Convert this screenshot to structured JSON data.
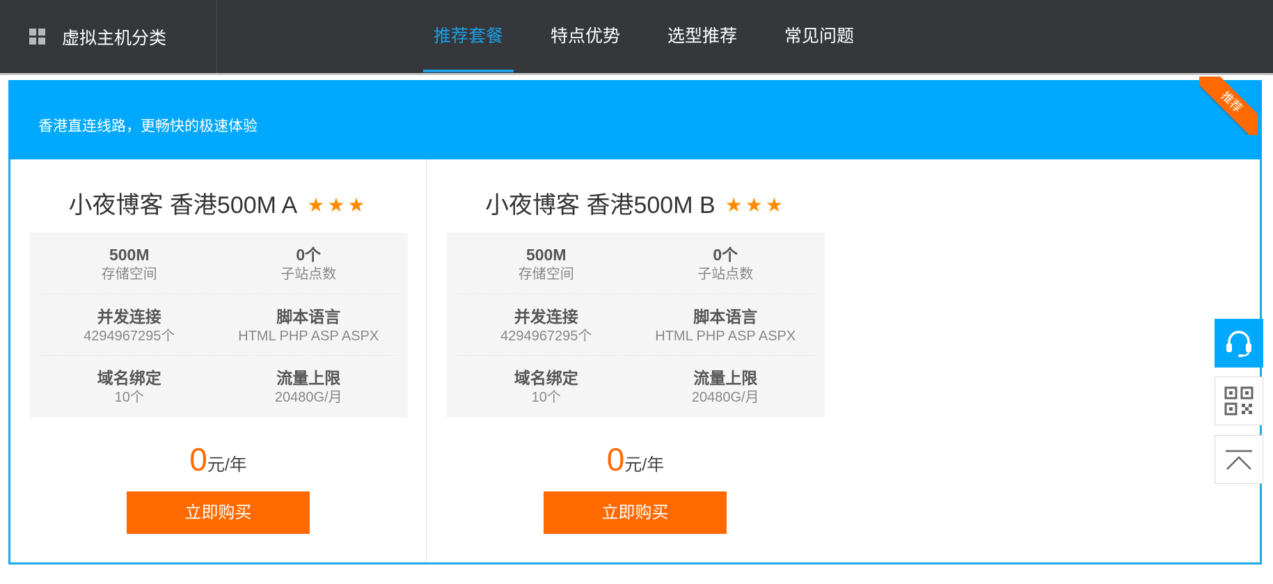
{
  "topbar": {
    "category_label": "虚拟主机分类",
    "nav": [
      {
        "label": "推荐套餐",
        "active": true
      },
      {
        "label": "特点优势",
        "active": false
      },
      {
        "label": "选型推荐",
        "active": false
      },
      {
        "label": "常见问题",
        "active": false
      }
    ]
  },
  "banner": {
    "text": "香港直连线路，更畅快的极速体验",
    "ribbon": "推荐"
  },
  "plans": [
    {
      "title": "小夜博客 香港500M A",
      "stars": "★★★",
      "specs": [
        {
          "key": "500M",
          "value": "存储空间"
        },
        {
          "key": "0个",
          "value": "子站点数"
        },
        {
          "key": "并发连接",
          "value": "4294967295个"
        },
        {
          "key": "脚本语言",
          "value": "HTML PHP ASP ASPX"
        },
        {
          "key": "域名绑定",
          "value": "10个"
        },
        {
          "key": "流量上限",
          "value": "20480G/月"
        }
      ],
      "price": "0",
      "price_unit": "元/年",
      "buy_label": "立即购买"
    },
    {
      "title": "小夜博客 香港500M B",
      "stars": "★★★",
      "specs": [
        {
          "key": "500M",
          "value": "存储空间"
        },
        {
          "key": "0个",
          "value": "子站点数"
        },
        {
          "key": "并发连接",
          "value": "4294967295个"
        },
        {
          "key": "脚本语言",
          "value": "HTML PHP ASP ASPX"
        },
        {
          "key": "域名绑定",
          "value": "10个"
        },
        {
          "key": "流量上限",
          "value": "20480G/月"
        }
      ],
      "price": "0",
      "price_unit": "元/年",
      "buy_label": "立即购买"
    }
  ],
  "side_tools": {
    "service_icon": "headset-icon",
    "qr_icon": "qr-code-icon",
    "top_icon": "back-to-top-icon"
  },
  "colors": {
    "nav_bg": "#35373b",
    "accent_blue": "#00a9fd",
    "active_nav": "#1c9fe3",
    "orange": "#ff6a00",
    "star": "#ff8a00"
  }
}
